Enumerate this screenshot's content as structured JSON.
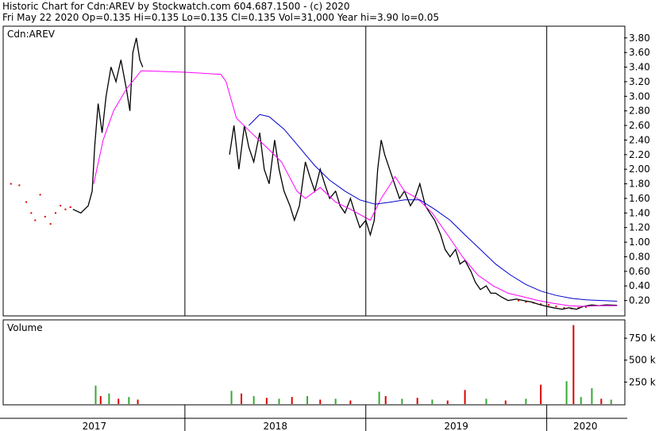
{
  "header": {
    "line1": "Historic Chart for Cdn:AREV by Stockwatch.com 604.687.1500 - (c) 2020",
    "line2": "Fri May 22 2020  Op=0.135  Hi=0.135  Lo=0.135  Cl=0.135  Vol=31,000  Year hi=3.90  lo=0.05"
  },
  "colors": {
    "price": "#000000",
    "ma_fast": "#ff00ff",
    "ma_slow": "#0000cc",
    "vol_up": "#33aa33",
    "vol_down": "#dd0000",
    "dot": "#dd0000"
  },
  "chart_data": [
    {
      "type": "line",
      "title": "Cdn:AREV",
      "ylim": [
        0.0,
        3.95
      ],
      "yticks": [
        "3.80",
        "3.60",
        "3.40",
        "3.20",
        "3.00",
        "2.80",
        "2.60",
        "2.40",
        "2.20",
        "2.00",
        "1.80",
        "1.60",
        "1.40",
        "1.20",
        "1.00",
        "0.80",
        "0.60",
        "0.40",
        "0.20"
      ],
      "xlim": [
        "2017-01-01",
        "2020-06-05"
      ],
      "series": [
        {
          "key": "price",
          "points": [
            [
              "2017-05-20",
              1.45
            ],
            [
              "2017-06-05",
              1.4
            ],
            [
              "2017-06-20",
              1.5
            ],
            [
              "2017-06-28",
              1.7
            ],
            [
              "2017-07-03",
              2.3
            ],
            [
              "2017-07-10",
              2.9
            ],
            [
              "2017-07-18",
              2.5
            ],
            [
              "2017-07-26",
              3.0
            ],
            [
              "2017-08-05",
              3.4
            ],
            [
              "2017-08-15",
              3.2
            ],
            [
              "2017-08-25",
              3.5
            ],
            [
              "2017-09-05",
              3.1
            ],
            [
              "2017-09-12",
              2.8
            ],
            [
              "2017-09-18",
              3.6
            ],
            [
              "2017-09-25",
              3.8
            ],
            [
              "2017-10-02",
              3.5
            ],
            [
              "2017-10-08",
              3.4
            ],
            [
              "2018-04-01",
              2.2
            ],
            [
              "2018-04-10",
              2.6
            ],
            [
              "2018-04-20",
              2.0
            ],
            [
              "2018-05-01",
              2.6
            ],
            [
              "2018-05-10",
              2.3
            ],
            [
              "2018-05-20",
              2.1
            ],
            [
              "2018-06-01",
              2.5
            ],
            [
              "2018-06-10",
              2.0
            ],
            [
              "2018-06-20",
              1.8
            ],
            [
              "2018-07-01",
              2.4
            ],
            [
              "2018-07-10",
              2.0
            ],
            [
              "2018-07-20",
              1.7
            ],
            [
              "2018-08-01",
              1.5
            ],
            [
              "2018-08-10",
              1.3
            ],
            [
              "2018-08-20",
              1.5
            ],
            [
              "2018-09-01",
              2.1
            ],
            [
              "2018-09-10",
              1.9
            ],
            [
              "2018-09-20",
              1.7
            ],
            [
              "2018-10-01",
              2.0
            ],
            [
              "2018-10-10",
              1.8
            ],
            [
              "2018-10-20",
              1.6
            ],
            [
              "2018-11-01",
              1.7
            ],
            [
              "2018-11-10",
              1.5
            ],
            [
              "2018-11-20",
              1.4
            ],
            [
              "2018-12-01",
              1.6
            ],
            [
              "2018-12-10",
              1.4
            ],
            [
              "2018-12-20",
              1.2
            ],
            [
              "2019-01-01",
              1.3
            ],
            [
              "2019-01-10",
              1.1
            ],
            [
              "2019-01-18",
              1.3
            ],
            [
              "2019-01-25",
              2.0
            ],
            [
              "2019-02-01",
              2.4
            ],
            [
              "2019-02-08",
              2.2
            ],
            [
              "2019-02-18",
              2.0
            ],
            [
              "2019-02-28",
              1.8
            ],
            [
              "2019-03-10",
              1.6
            ],
            [
              "2019-03-20",
              1.7
            ],
            [
              "2019-04-01",
              1.5
            ],
            [
              "2019-04-10",
              1.6
            ],
            [
              "2019-04-20",
              1.8
            ],
            [
              "2019-05-01",
              1.5
            ],
            [
              "2019-05-10",
              1.4
            ],
            [
              "2019-05-20",
              1.3
            ],
            [
              "2019-06-01",
              1.1
            ],
            [
              "2019-06-10",
              0.9
            ],
            [
              "2019-06-20",
              0.8
            ],
            [
              "2019-07-01",
              0.9
            ],
            [
              "2019-07-10",
              0.7
            ],
            [
              "2019-07-20",
              0.75
            ],
            [
              "2019-08-01",
              0.6
            ],
            [
              "2019-08-10",
              0.45
            ],
            [
              "2019-08-20",
              0.35
            ],
            [
              "2019-09-01",
              0.4
            ],
            [
              "2019-09-10",
              0.3
            ],
            [
              "2019-09-20",
              0.3
            ],
            [
              "2019-10-01",
              0.25
            ],
            [
              "2019-10-15",
              0.2
            ],
            [
              "2019-11-01",
              0.22
            ],
            [
              "2019-11-15",
              0.2
            ],
            [
              "2019-12-01",
              0.18
            ],
            [
              "2019-12-15",
              0.15
            ],
            [
              "2020-01-01",
              0.12
            ],
            [
              "2020-01-15",
              0.1
            ],
            [
              "2020-02-01",
              0.08
            ],
            [
              "2020-02-15",
              0.1
            ],
            [
              "2020-03-01",
              0.08
            ],
            [
              "2020-03-15",
              0.12
            ],
            [
              "2020-04-01",
              0.14
            ],
            [
              "2020-04-15",
              0.13
            ],
            [
              "2020-05-01",
              0.14
            ],
            [
              "2020-05-22",
              0.135
            ]
          ]
        },
        {
          "key": "ma_fast",
          "points": [
            [
              "2017-07-01",
              1.8
            ],
            [
              "2017-07-20",
              2.4
            ],
            [
              "2017-08-10",
              2.8
            ],
            [
              "2017-09-05",
              3.1
            ],
            [
              "2017-10-05",
              3.35
            ],
            [
              "2018-01-01",
              3.33
            ],
            [
              "2018-03-15",
              3.3
            ],
            [
              "2018-03-25",
              3.2
            ],
            [
              "2018-04-15",
              2.7
            ],
            [
              "2018-05-15",
              2.5
            ],
            [
              "2018-06-15",
              2.3
            ],
            [
              "2018-07-15",
              2.1
            ],
            [
              "2018-08-15",
              1.7
            ],
            [
              "2018-09-01",
              1.6
            ],
            [
              "2018-10-01",
              1.75
            ],
            [
              "2018-11-01",
              1.55
            ],
            [
              "2018-12-01",
              1.45
            ],
            [
              "2019-01-10",
              1.3
            ],
            [
              "2019-02-01",
              1.6
            ],
            [
              "2019-02-20",
              1.8
            ],
            [
              "2019-03-01",
              1.9
            ],
            [
              "2019-03-20",
              1.7
            ],
            [
              "2019-04-15",
              1.6
            ],
            [
              "2019-05-15",
              1.4
            ],
            [
              "2019-06-15",
              1.1
            ],
            [
              "2019-07-15",
              0.8
            ],
            [
              "2019-08-15",
              0.55
            ],
            [
              "2019-09-15",
              0.4
            ],
            [
              "2019-10-15",
              0.3
            ],
            [
              "2019-11-15",
              0.25
            ],
            [
              "2019-12-15",
              0.2
            ],
            [
              "2020-01-15",
              0.16
            ],
            [
              "2020-02-15",
              0.13
            ],
            [
              "2020-03-15",
              0.12
            ],
            [
              "2020-04-15",
              0.13
            ],
            [
              "2020-05-22",
              0.13
            ]
          ]
        },
        {
          "key": "ma_slow",
          "points": [
            [
              "2018-05-10",
              2.6
            ],
            [
              "2018-06-01",
              2.75
            ],
            [
              "2018-06-20",
              2.72
            ],
            [
              "2018-07-20",
              2.55
            ],
            [
              "2018-08-20",
              2.3
            ],
            [
              "2018-09-20",
              2.05
            ],
            [
              "2018-10-20",
              1.85
            ],
            [
              "2018-11-20",
              1.7
            ],
            [
              "2018-12-20",
              1.58
            ],
            [
              "2019-01-20",
              1.52
            ],
            [
              "2019-02-20",
              1.55
            ],
            [
              "2019-03-20",
              1.58
            ],
            [
              "2019-04-20",
              1.58
            ],
            [
              "2019-05-20",
              1.45
            ],
            [
              "2019-06-20",
              1.3
            ],
            [
              "2019-07-20",
              1.1
            ],
            [
              "2019-08-20",
              0.9
            ],
            [
              "2019-09-20",
              0.7
            ],
            [
              "2019-10-20",
              0.55
            ],
            [
              "2019-11-20",
              0.42
            ],
            [
              "2019-12-20",
              0.33
            ],
            [
              "2020-01-20",
              0.27
            ],
            [
              "2020-02-20",
              0.23
            ],
            [
              "2020-03-20",
              0.21
            ],
            [
              "2020-04-20",
              0.2
            ],
            [
              "2020-05-22",
              0.19
            ]
          ]
        }
      ],
      "dots": [
        [
          "2017-01-15",
          1.8
        ],
        [
          "2017-02-01",
          1.78
        ],
        [
          "2017-02-15",
          1.55
        ],
        [
          "2017-02-25",
          1.4
        ],
        [
          "2017-03-05",
          1.3
        ],
        [
          "2017-03-15",
          1.65
        ],
        [
          "2017-03-25",
          1.35
        ],
        [
          "2017-04-05",
          1.25
        ],
        [
          "2017-04-15",
          1.4
        ],
        [
          "2017-04-25",
          1.5
        ],
        [
          "2017-05-05",
          1.45
        ],
        [
          "2017-05-15",
          1.48
        ],
        [
          "2019-11-05",
          0.2
        ],
        [
          "2019-11-20",
          0.18
        ],
        [
          "2019-12-05",
          0.17
        ],
        [
          "2019-12-20",
          0.15
        ],
        [
          "2020-01-05",
          0.14
        ],
        [
          "2020-01-20",
          0.12
        ],
        [
          "2020-02-05",
          0.1
        ],
        [
          "2020-02-20",
          0.09
        ],
        [
          "2020-03-05",
          0.1
        ],
        [
          "2020-03-20",
          0.11
        ]
      ]
    },
    {
      "type": "bar",
      "title": "Volume",
      "ylim": [
        0,
        950
      ],
      "yticks": [
        "750 k",
        "500 k",
        "250 k"
      ],
      "bars": [
        [
          "2017-07-05",
          210,
          "up"
        ],
        [
          "2017-07-15",
          90,
          "down"
        ],
        [
          "2017-08-01",
          120,
          "up"
        ],
        [
          "2017-08-20",
          60,
          "down"
        ],
        [
          "2017-09-10",
          80,
          "up"
        ],
        [
          "2017-09-28",
          50,
          "down"
        ],
        [
          "2018-04-05",
          150,
          "up"
        ],
        [
          "2018-04-25",
          120,
          "down"
        ],
        [
          "2018-05-20",
          90,
          "up"
        ],
        [
          "2018-06-15",
          70,
          "down"
        ],
        [
          "2018-07-10",
          60,
          "up"
        ],
        [
          "2018-08-05",
          80,
          "down"
        ],
        [
          "2018-09-05",
          90,
          "up"
        ],
        [
          "2018-10-01",
          50,
          "down"
        ],
        [
          "2018-11-01",
          60,
          "up"
        ],
        [
          "2018-12-01",
          40,
          "down"
        ],
        [
          "2019-01-28",
          140,
          "up"
        ],
        [
          "2019-02-10",
          90,
          "down"
        ],
        [
          "2019-03-15",
          60,
          "up"
        ],
        [
          "2019-04-15",
          70,
          "down"
        ],
        [
          "2019-05-15",
          50,
          "up"
        ],
        [
          "2019-06-15",
          40,
          "down"
        ],
        [
          "2019-07-20",
          160,
          "down"
        ],
        [
          "2019-09-01",
          60,
          "up"
        ],
        [
          "2019-10-10",
          40,
          "down"
        ],
        [
          "2019-11-20",
          60,
          "up"
        ],
        [
          "2019-12-20",
          220,
          "down"
        ],
        [
          "2020-02-10",
          260,
          "up"
        ],
        [
          "2020-02-24",
          900,
          "down"
        ],
        [
          "2020-03-10",
          80,
          "up"
        ],
        [
          "2020-04-01",
          180,
          "up"
        ],
        [
          "2020-04-20",
          60,
          "down"
        ],
        [
          "2020-05-10",
          50,
          "up"
        ]
      ]
    }
  ],
  "x_axis": {
    "labels": [
      "2017",
      "2018",
      "2019",
      "2020"
    ]
  }
}
